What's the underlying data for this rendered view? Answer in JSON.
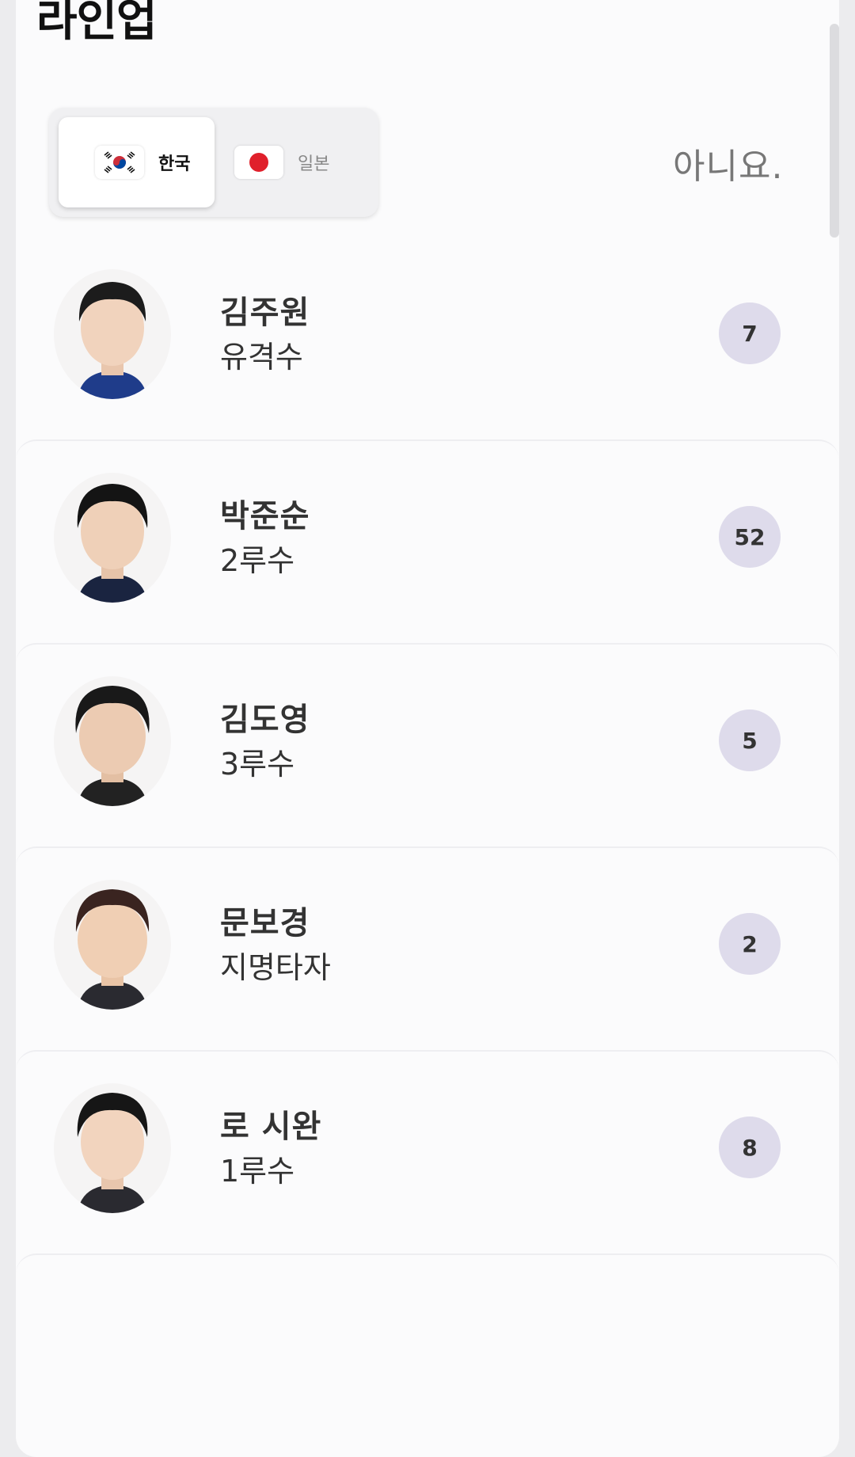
{
  "page": {
    "title": "라인업"
  },
  "tabs": [
    {
      "label": "한국",
      "flag": "korea-flag",
      "active": true
    },
    {
      "label": "일본",
      "flag": "japan-flag",
      "active": false
    }
  ],
  "status_text": "아니요.",
  "players": [
    {
      "name": "김주원",
      "position": "유격수",
      "number": "7",
      "jersey": "#1f3c8a"
    },
    {
      "name": "박준순",
      "position": "2루수",
      "number": "52",
      "jersey": "#1a2440"
    },
    {
      "name": "김도영",
      "position": "3루수",
      "number": "5",
      "jersey": "#222222"
    },
    {
      "name": "문보경",
      "position": "지명타자",
      "number": "2",
      "jersey": "#2a2a30"
    },
    {
      "name": "로 시완",
      "position": "1루수",
      "number": "8",
      "jersey": "#2a2a30"
    }
  ],
  "colors": {
    "number_badge": "#dedbeb",
    "japan_red": "#e0202b"
  }
}
